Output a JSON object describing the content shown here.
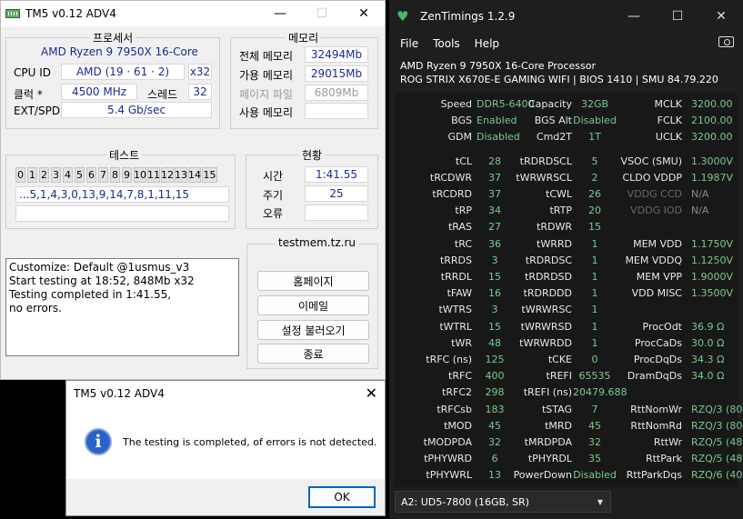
{
  "tm5": {
    "title": "TM5 v0.12 ADV4",
    "min": "—",
    "max": "☐",
    "close": "✕",
    "processor_group": "프로세서",
    "cpu_name": "AMD Ryzen 9 7950X 16-Core",
    "cpu_id_label": "CPU ID",
    "cpu_id_value": "AMD  (19 · 61 · 2)",
    "cpu_mult": "x32",
    "clock_label": "클럭 *",
    "clock_value": "4500 MHz",
    "threads_label": "스레드",
    "threads_value": "32",
    "extspd_label": "EXT/SPD",
    "extspd_value": "5.4 Gb/sec",
    "memory_group": "메모리",
    "mem_total_label": "전체 메모리",
    "mem_total": "32494Mb",
    "mem_avail_label": "가용 메모리",
    "mem_avail": "29015Mb",
    "mem_page_label": "페이지 파일",
    "mem_page": "6809Mb",
    "mem_used_label": "사용 메모리",
    "mem_used": "",
    "test_group": "테스트",
    "test_cells": [
      "0",
      "1",
      "2",
      "3",
      "4",
      "5",
      "6",
      "7",
      "8",
      "9",
      "10",
      "11",
      "12",
      "13",
      "14",
      "15"
    ],
    "test_sequence": "...5,1,4,3,0,13,9,14,7,8,1,11,15",
    "status_group": "현황",
    "time_label": "시간",
    "time_value": "1:41.55",
    "cycle_label": "주기",
    "cycle_value": "25",
    "error_label": "오류",
    "error_value": "",
    "log_lines": [
      "Customize: Default @1usmus_v3",
      "Start testing at 18:52, 848Mb x32",
      "Testing completed in 1:41.55,",
      "no errors."
    ],
    "site_group": "testmem.tz.ru",
    "btn_homepage": "홈페이지",
    "btn_email": "이메일",
    "btn_load": "설정 불러오기",
    "btn_exit": "종료"
  },
  "dialog": {
    "title": "TM5 v0.12 ADV4",
    "close": "✕",
    "icon": "i",
    "message": "The testing is completed, of errors is not detected.",
    "ok": "OK"
  },
  "zen": {
    "title": "ZenTimings 1.2.9",
    "min": "—",
    "max": "☐",
    "close": "✕",
    "logo": "♥",
    "menu": [
      "File",
      "Tools",
      "Help"
    ],
    "cpu": "AMD Ryzen 9 7950X 16-Core Processor",
    "board": "ROG STRIX X670E-E GAMING WIFI | BIOS 1410 | SMU 84.79.220",
    "rows": [
      [
        [
          "Speed",
          "DDR5-6400"
        ],
        [
          "Capacity",
          "32GB"
        ],
        [
          "MCLK",
          "3200.00"
        ]
      ],
      [
        [
          "BGS",
          "Enabled"
        ],
        [
          "BGS Alt",
          "Disabled"
        ],
        [
          "FCLK",
          "2100.00"
        ]
      ],
      [
        [
          "GDM",
          "Disabled"
        ],
        [
          "Cmd2T",
          "1T"
        ],
        [
          "UCLK",
          "3200.00"
        ]
      ],
      [
        [
          "tCL",
          "28"
        ],
        [
          "tRDRDSCL",
          "5"
        ],
        [
          "VSOC (SMU)",
          "1.3000V"
        ]
      ],
      [
        [
          "tRCDWR",
          "37"
        ],
        [
          "tWRWRSCL",
          "2"
        ],
        [
          "CLDO VDDP",
          "1.1987V"
        ]
      ],
      [
        [
          "tRCDRD",
          "37"
        ],
        [
          "tCWL",
          "26"
        ],
        [
          "VDDG CCD",
          "N/A"
        ]
      ],
      [
        [
          "tRP",
          "34"
        ],
        [
          "tRTP",
          "20"
        ],
        [
          "VDDG IOD",
          "N/A"
        ]
      ],
      [
        [
          "tRAS",
          "27"
        ],
        [
          "tRDWR",
          "15"
        ],
        [
          "",
          ""
        ]
      ],
      [
        [
          "tRC",
          "36"
        ],
        [
          "tWRRD",
          "1"
        ],
        [
          "MEM VDD",
          "1.1750V"
        ]
      ],
      [
        [
          "tRRDS",
          "3"
        ],
        [
          "tRDRDSC",
          "1"
        ],
        [
          "MEM VDDQ",
          "1.1250V"
        ]
      ],
      [
        [
          "tRRDL",
          "15"
        ],
        [
          "tRDRDSD",
          "1"
        ],
        [
          "MEM VPP",
          "1.9000V"
        ]
      ],
      [
        [
          "tFAW",
          "16"
        ],
        [
          "tRDRDDD",
          "1"
        ],
        [
          "VDD MISC",
          "1.3500V"
        ]
      ],
      [
        [
          "tWTRS",
          "3"
        ],
        [
          "tWRWRSC",
          "1"
        ],
        [
          "",
          ""
        ]
      ],
      [
        [
          "tWTRL",
          "15"
        ],
        [
          "tWRWRSD",
          "1"
        ],
        [
          "ProcOdt",
          "36.9 Ω"
        ]
      ],
      [
        [
          "tWR",
          "48"
        ],
        [
          "tWRWRDD",
          "1"
        ],
        [
          "ProcCaDs",
          "30.0 Ω"
        ]
      ],
      [
        [
          "tRFC (ns)",
          "125"
        ],
        [
          "tCKE",
          "0"
        ],
        [
          "ProcDqDs",
          "34.3 Ω"
        ]
      ],
      [
        [
          "tRFC",
          "400"
        ],
        [
          "tREFI",
          "65535"
        ],
        [
          "DramDqDs",
          "34.0 Ω"
        ]
      ],
      [
        [
          "tRFC2",
          "298"
        ],
        [
          "tREFI (ns)",
          "20479.688"
        ],
        [
          "",
          ""
        ]
      ],
      [
        [
          "tRFCsb",
          "183"
        ],
        [
          "tSTAG",
          "7"
        ],
        [
          "RttNomWr",
          "RZQ/3 (80)"
        ]
      ],
      [
        [
          "tMOD",
          "45"
        ],
        [
          "tMRD",
          "45"
        ],
        [
          "RttNomRd",
          "RZQ/3 (80)"
        ]
      ],
      [
        [
          "tMODPDA",
          "32"
        ],
        [
          "tMRDPDA",
          "32"
        ],
        [
          "RttWr",
          "RZQ/5 (48)"
        ]
      ],
      [
        [
          "tPHYWRD",
          "6"
        ],
        [
          "tPHYRDL",
          "35"
        ],
        [
          "RttPark",
          "RZQ/5 (48)"
        ]
      ],
      [
        [
          "tPHYWRL",
          "13"
        ],
        [
          "PowerDown",
          "Disabled"
        ],
        [
          "RttParkDqs",
          "RZQ/6 (40)"
        ]
      ]
    ],
    "dimm_select": "A2: UD5-7800 (16GB, SR)",
    "dropdown_arrow": "▼"
  },
  "colors": {
    "value_green": "#7ac98c",
    "tm5_value_blue": "#1a2a90",
    "dialog_accent": "#0067c0"
  }
}
